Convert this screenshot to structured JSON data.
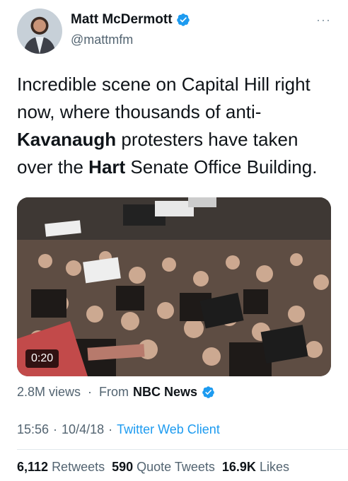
{
  "author": {
    "name": "Matt McDermott",
    "handle": "@mattmfm",
    "verified": true
  },
  "tweet": {
    "text_parts": [
      {
        "text": "Incredible scene on Capital Hill right now, where thousands of anti-",
        "bold": false
      },
      {
        "text": "Kavanaugh",
        "bold": true
      },
      {
        "text": " protesters have taken over the ",
        "bold": false
      },
      {
        "text": "Hart",
        "bold": true
      },
      {
        "text": " Senate Office Building.",
        "bold": false
      }
    ]
  },
  "video": {
    "duration": "0:20"
  },
  "views": {
    "count": "2.8M views",
    "separator": "·",
    "from_label": "From",
    "source": "NBC News"
  },
  "meta": {
    "time": "15:56",
    "separator": "·",
    "date": "10/4/18",
    "separator2": "·",
    "client": "Twitter Web Client"
  },
  "stats": {
    "retweets": {
      "count": "6,112",
      "label": "Retweets"
    },
    "quotes": {
      "count": "590",
      "label": "Quote Tweets"
    },
    "likes": {
      "count": "16.9K",
      "label": "Likes"
    }
  },
  "colors": {
    "accent": "#1d9bf0",
    "text": "#0f1419",
    "muted": "#536471"
  },
  "icons": {
    "verified": "verified-badge-icon",
    "more": "more-icon"
  }
}
